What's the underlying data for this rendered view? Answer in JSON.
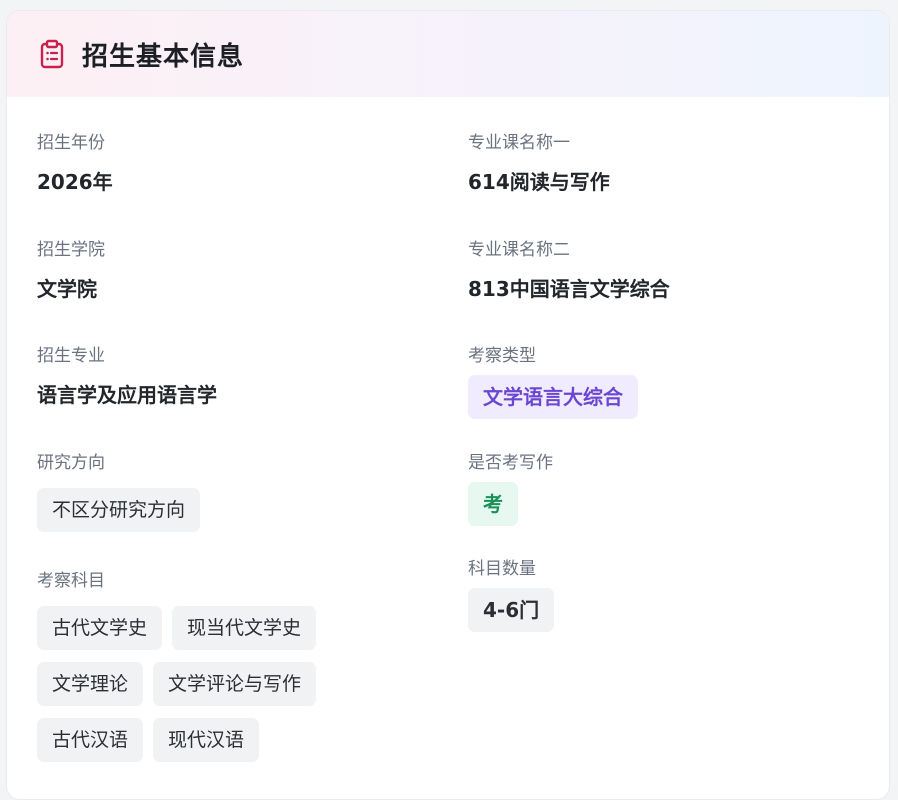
{
  "header": {
    "title": "招生基本信息",
    "icon": "clipboard-icon",
    "accent_color": "#c8204f"
  },
  "left": {
    "year": {
      "label": "招生年份",
      "value": "2026年"
    },
    "college": {
      "label": "招生学院",
      "value": "文学院"
    },
    "major": {
      "label": "招生专业",
      "value": "语言学及应用语言学"
    },
    "direction": {
      "label": "研究方向",
      "value": "不区分研究方向"
    },
    "subjects": {
      "label": "考察科目",
      "items": [
        "古代文学史",
        "现当代文学史",
        "文学理论",
        "文学评论与写作",
        "古代汉语",
        "现代汉语"
      ]
    }
  },
  "right": {
    "course1": {
      "label": "专业课名称一",
      "value": "614阅读与写作"
    },
    "course2": {
      "label": "专业课名称二",
      "value": "813中国语言文学综合"
    },
    "exam_type": {
      "label": "考察类型",
      "value": "文学语言大综合",
      "color": "#6b46d3"
    },
    "writing": {
      "label": "是否考写作",
      "value": "考",
      "color": "#1a8f5a"
    },
    "count": {
      "label": "科目数量",
      "value": "4-6门"
    }
  }
}
